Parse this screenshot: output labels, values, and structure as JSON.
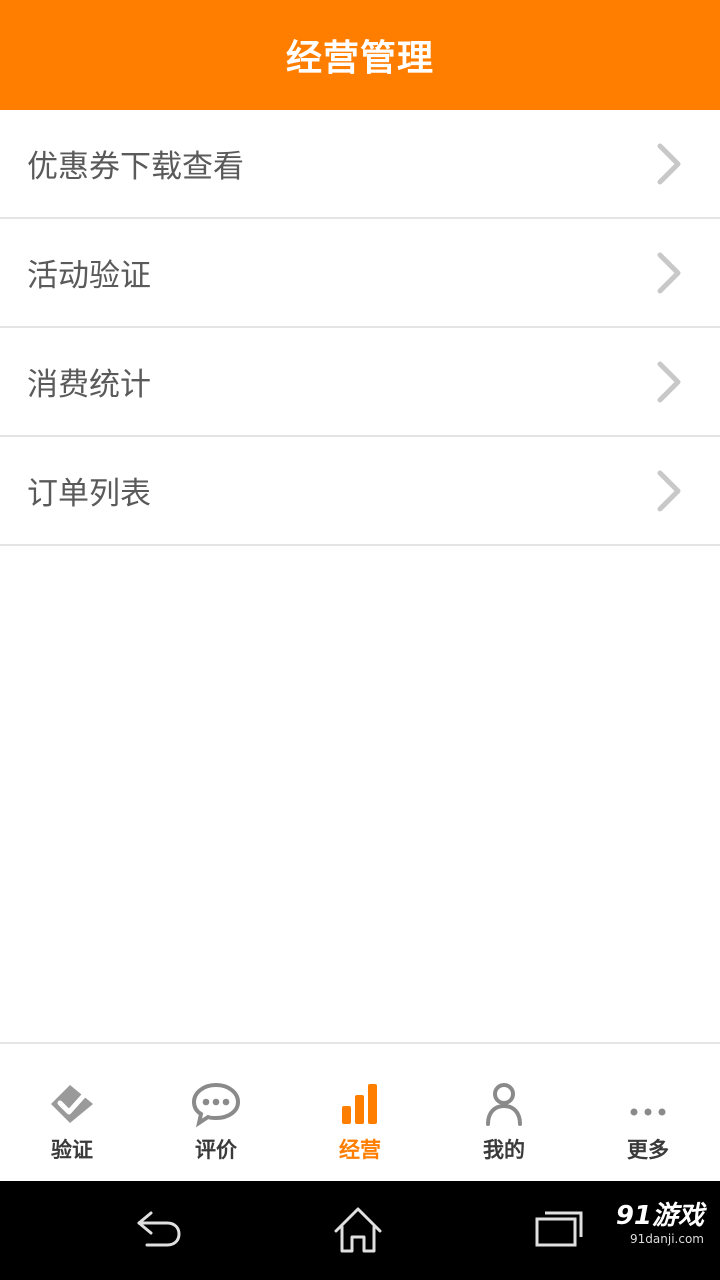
{
  "header": {
    "title": "经营管理"
  },
  "menu": [
    {
      "label": "优惠券下载查看",
      "icon": "chevron-right-icon"
    },
    {
      "label": "活动验证",
      "icon": "chevron-right-icon"
    },
    {
      "label": "消费统计",
      "icon": "chevron-right-icon"
    },
    {
      "label": "订单列表",
      "icon": "chevron-right-icon"
    }
  ],
  "tabs": [
    {
      "label": "验证",
      "icon": "verify-check-icon",
      "active": false
    },
    {
      "label": "评价",
      "icon": "chat-bubble-icon",
      "active": false
    },
    {
      "label": "经营",
      "icon": "bar-chart-icon",
      "active": true
    },
    {
      "label": "我的",
      "icon": "person-icon",
      "active": false
    },
    {
      "label": "更多",
      "icon": "more-dots-icon",
      "active": false
    }
  ],
  "colors": {
    "accent": "#ff7e00",
    "tab_inactive": "#8a8a8a",
    "chevron": "#c8c8c8"
  },
  "system_nav": [
    "back-icon",
    "home-icon",
    "recent-apps-icon"
  ],
  "watermark": {
    "main": "91游戏",
    "sub": "91danji.com"
  }
}
